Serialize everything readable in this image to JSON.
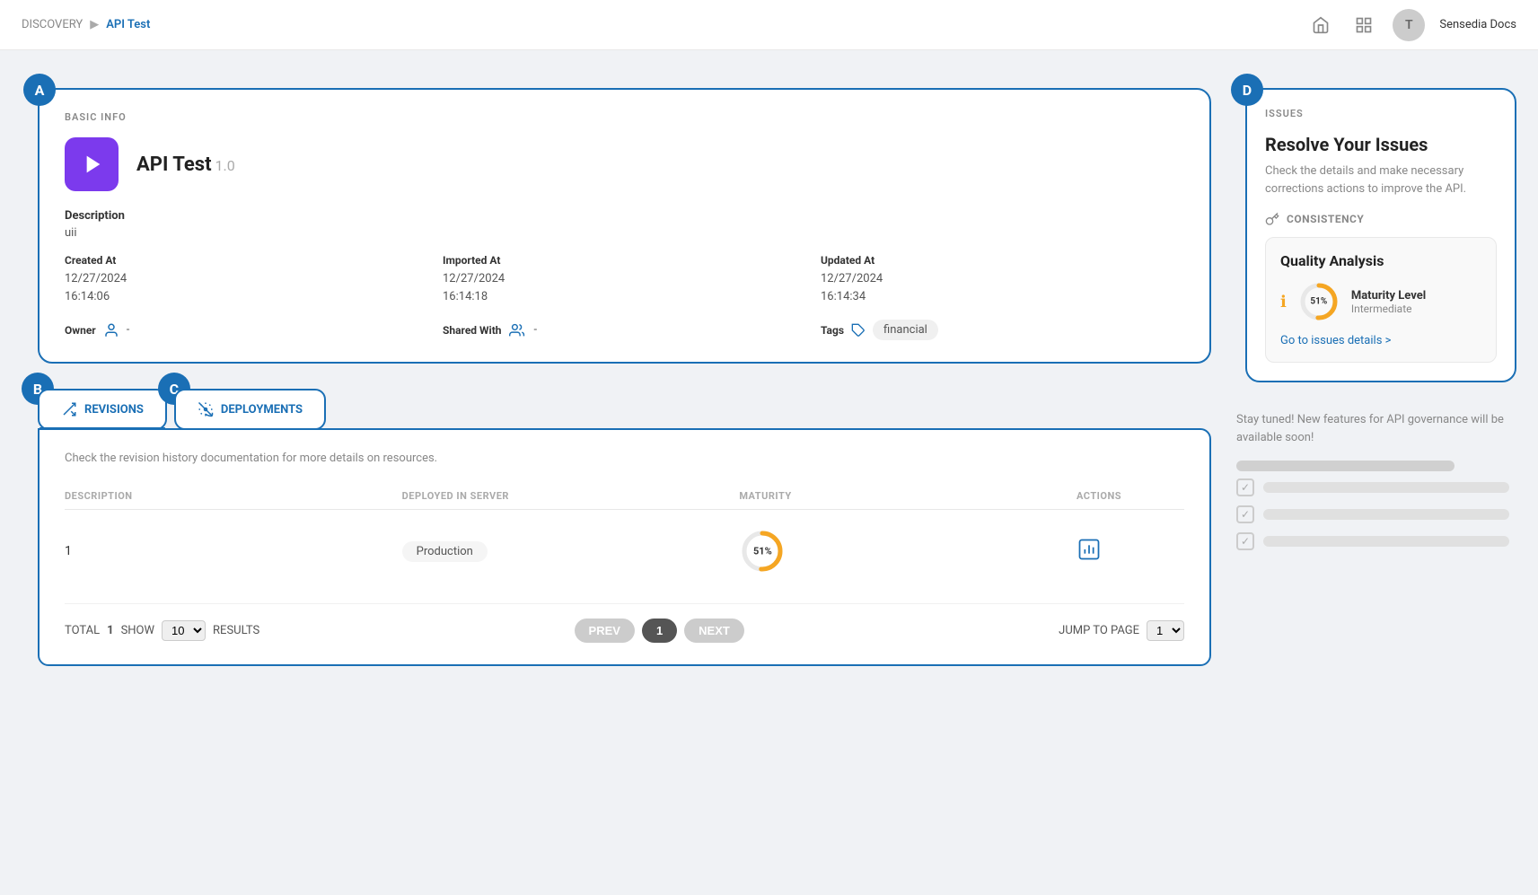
{
  "nav": {
    "breadcrumb_parent": "DISCOVERY",
    "breadcrumb_current": "API Test",
    "docs_link": "Sensedia Docs"
  },
  "basic_info": {
    "section_label": "BASIC INFO",
    "api_name": "API Test",
    "api_version": "1.0",
    "description_label": "Description",
    "description_value": "uii",
    "created_at_label": "Created At",
    "created_at_date": "12/27/2024",
    "created_at_time": "16:14:06",
    "imported_at_label": "Imported At",
    "imported_at_date": "12/27/2024",
    "imported_at_time": "16:14:18",
    "updated_at_label": "Updated At",
    "updated_at_date": "12/27/2024",
    "updated_at_time": "16:14:34",
    "owner_label": "Owner",
    "owner_value": "-",
    "shared_with_label": "Shared With",
    "shared_with_value": "-",
    "tags_label": "Tags",
    "tags_value": "financial"
  },
  "tabs": {
    "revisions_label": "REVISIONS",
    "deployments_label": "DEPLOYMENTS",
    "tab_description": "Check the revision history documentation for more details on resources.",
    "table_headers": {
      "description": "DESCRIPTION",
      "deployed_in_server": "DEPLOYED IN SERVER",
      "maturity": "MATURITY",
      "actions": "ACTIONS"
    },
    "rows": [
      {
        "description": "1",
        "deployed_in_server": "Production",
        "maturity_pct": 51,
        "maturity_label": "51%"
      }
    ],
    "pagination": {
      "total_label": "TOTAL",
      "total_value": "1",
      "show_label": "SHOW",
      "show_value": "10",
      "results_label": "RESULTS",
      "prev_label": "PREV",
      "current_page": "1",
      "next_label": "NEXT",
      "jump_label": "JUMP TO PAGE",
      "jump_value": "1"
    }
  },
  "issues": {
    "section_label": "ISSUES",
    "card_title": "Resolve Your Issues",
    "card_description": "Check the details and make necessary corrections actions to improve the API.",
    "consistency_label": "CONSISTENCY",
    "qa_title": "Quality Analysis",
    "maturity_pct": 51,
    "maturity_label": "51%",
    "maturity_level_label": "Maturity Level",
    "maturity_level_value": "Intermediate",
    "go_to_issues": "Go to issues details >",
    "stay_tuned_text": "Stay tuned! New features for API governance will be available soon!"
  },
  "badges": {
    "a": "A",
    "b": "B",
    "c": "C",
    "d": "D"
  }
}
